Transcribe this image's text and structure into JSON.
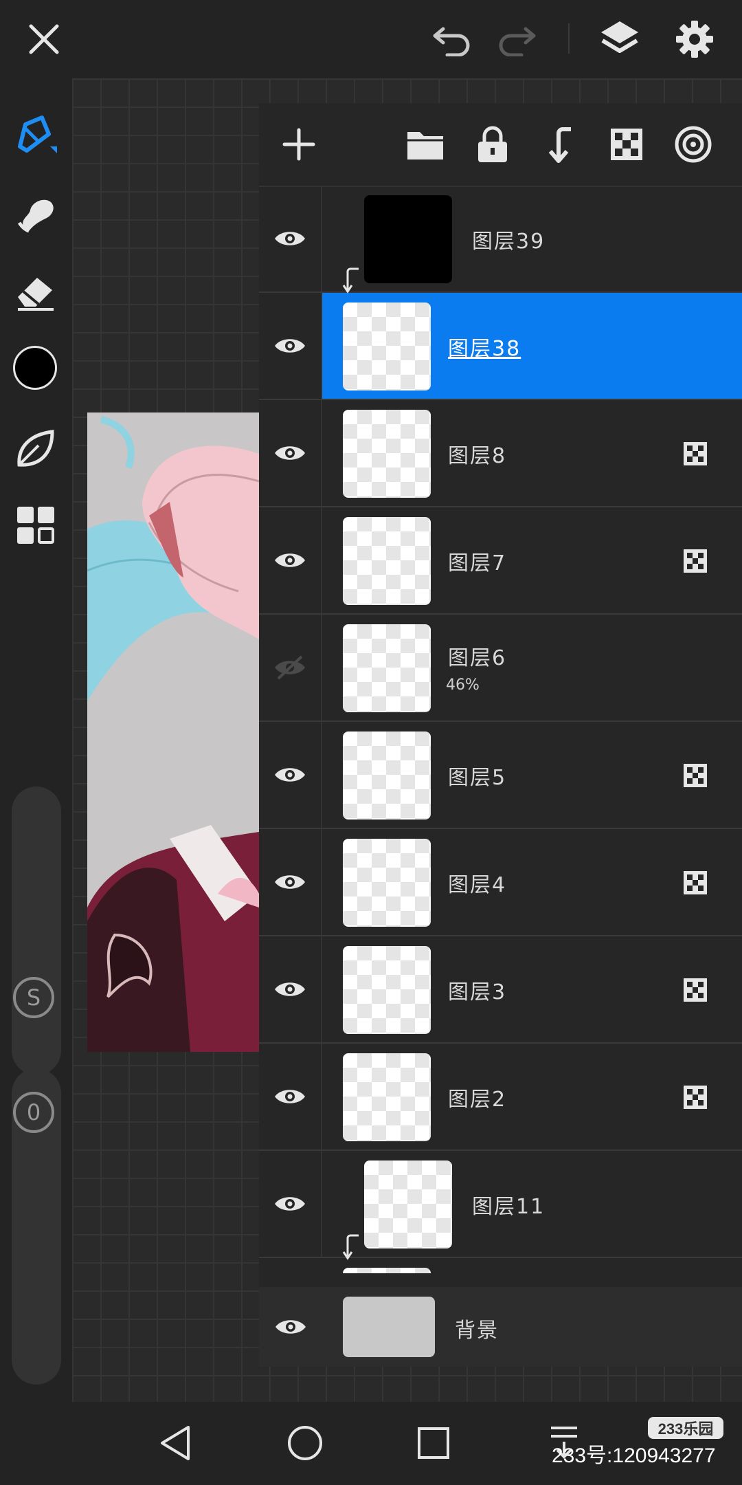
{
  "colors": {
    "accent": "#0a7cf0",
    "background": "#232323",
    "panel": "#262626",
    "current_color": "#000000"
  },
  "top_bar": {
    "icons": [
      "close-icon",
      "undo-icon",
      "redo-icon",
      "layers-icon",
      "settings-icon"
    ]
  },
  "left_toolbar": {
    "tools": [
      "brush-tool-icon",
      "smudge-tool-icon",
      "eraser-tool-icon",
      "color-swatch",
      "shape-tool-icon",
      "materials-icon"
    ],
    "size_button": "S",
    "opacity_button": "0"
  },
  "layer_panel": {
    "toolbar_icons": [
      "add-layer-icon",
      "folder-icon",
      "lock-icon",
      "merge-down-icon",
      "alpha-lock-icon",
      "blend-icon"
    ],
    "layers": [
      {
        "name": "图层39",
        "visible": true,
        "clipped": false,
        "alpha_lock": false,
        "selected": false,
        "opacity": ""
      },
      {
        "name": "图层38",
        "visible": true,
        "clipped": true,
        "alpha_lock": false,
        "selected": true,
        "opacity": ""
      },
      {
        "name": "图层8",
        "visible": true,
        "clipped": false,
        "alpha_lock": true,
        "selected": false,
        "opacity": ""
      },
      {
        "name": "图层7",
        "visible": true,
        "clipped": false,
        "alpha_lock": true,
        "selected": false,
        "opacity": ""
      },
      {
        "name": "图层6",
        "visible": false,
        "clipped": false,
        "alpha_lock": false,
        "selected": false,
        "opacity": "46%"
      },
      {
        "name": "图层5",
        "visible": true,
        "clipped": false,
        "alpha_lock": true,
        "selected": false,
        "opacity": ""
      },
      {
        "name": "图层4",
        "visible": true,
        "clipped": false,
        "alpha_lock": true,
        "selected": false,
        "opacity": ""
      },
      {
        "name": "图层3",
        "visible": true,
        "clipped": false,
        "alpha_lock": true,
        "selected": false,
        "opacity": ""
      },
      {
        "name": "图层2",
        "visible": true,
        "clipped": false,
        "alpha_lock": true,
        "selected": false,
        "opacity": ""
      },
      {
        "name": "图层11",
        "visible": true,
        "clipped": false,
        "alpha_lock": false,
        "selected": false,
        "opacity": ""
      }
    ],
    "background_layer": {
      "name": "背景",
      "visible": true
    }
  },
  "nav_bar": {
    "icons": [
      "back-icon",
      "home-icon",
      "recents-icon",
      "menu-icon"
    ]
  },
  "watermark": {
    "logo": "233乐园",
    "id": "233号:120943277"
  }
}
